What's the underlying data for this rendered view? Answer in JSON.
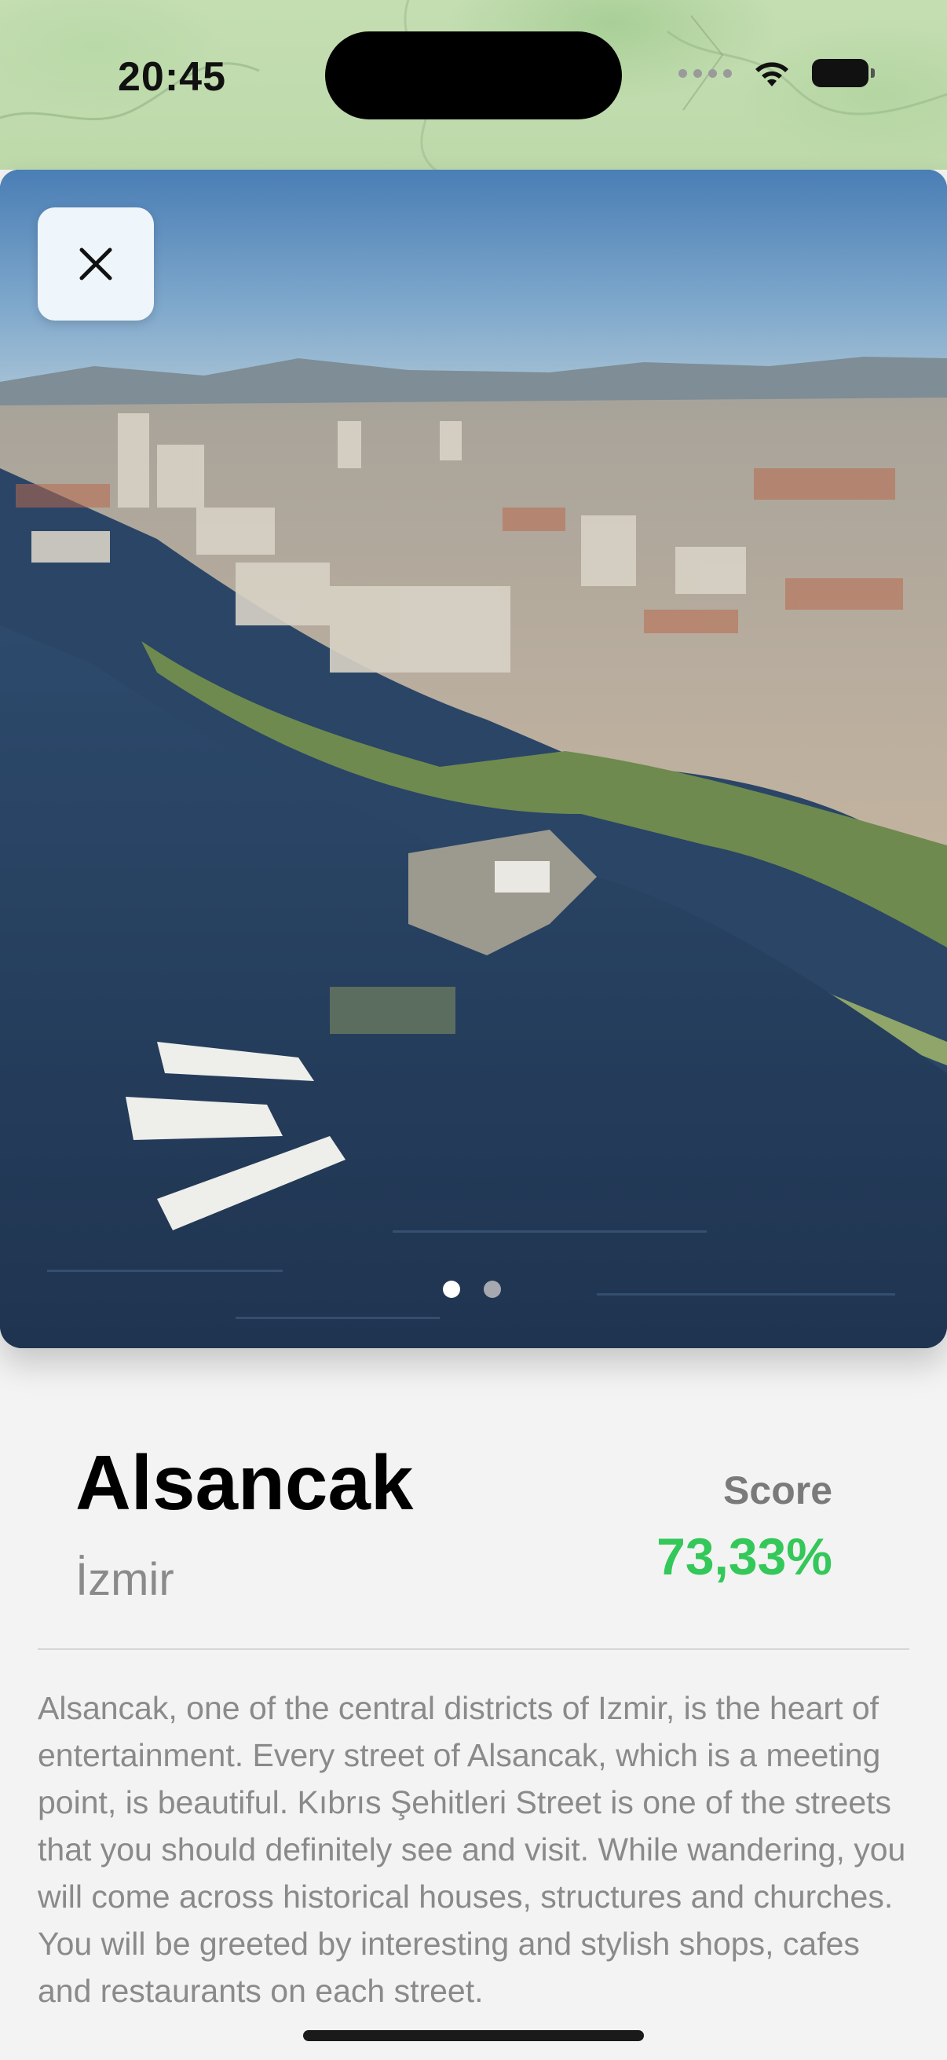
{
  "status_bar": {
    "time": "20:45",
    "icons": [
      "cellular-signal-icon",
      "wifi-icon",
      "battery-icon"
    ]
  },
  "gallery": {
    "image_subject": "aerial view of Alsancak waterfront with ferry pier",
    "page_count": 2,
    "current_page": 1
  },
  "place": {
    "name": "Alsancak",
    "city": "İzmir",
    "score_label": "Score",
    "score_value": "73,33%",
    "description": "Alsancak, one of the central districts of Izmir, is the heart of entertainment. Every street of Alsancak, which is a meeting point, is beautiful. Kıbrıs Şehitleri Street is one of the streets that you should definitely see and visit. While wandering, you will come across historical houses, structures and churches. You will be greeted by interesting and stylish shops, cafes and restaurants on each street."
  },
  "colors": {
    "score": "#34c759",
    "background": "#f3f3f3",
    "close_button_bg": "#eef6fb"
  }
}
